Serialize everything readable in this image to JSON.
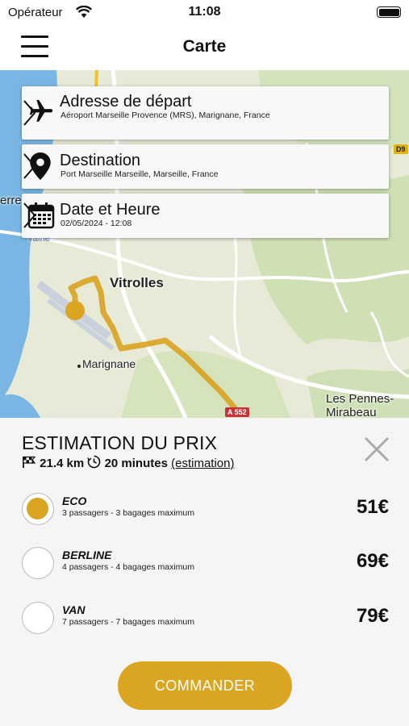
{
  "status_bar": {
    "carrier": "Opérateur",
    "time": "11:08"
  },
  "nav": {
    "title": "Carte"
  },
  "map": {
    "labels": {
      "vitrolles": "Vitrolles",
      "marignane": "Marignane",
      "pennes": "Les Pennes-\nMirabeau",
      "erre": "erre",
      "vaine": "Vaïne"
    },
    "badges": {
      "d9": "D9",
      "a552": "A 552"
    }
  },
  "cards": {
    "departure": {
      "title": "Adresse de départ",
      "subtitle": "Aéroport Marseille Provence (MRS), Marignane, France"
    },
    "destination": {
      "title": "Destination",
      "subtitle": "Port Marseille Marseille, Marseille, France"
    },
    "datetime": {
      "title": "Date et Heure",
      "subtitle": "02/05/2024 - 12:08"
    }
  },
  "estimate": {
    "title": "ESTIMATION DU PRIX",
    "distance": "21.4 km",
    "duration": "20 minutes",
    "note": "(estimation)"
  },
  "options": [
    {
      "name": "ECO",
      "desc": "3 passagers - 3 bagages maximum",
      "price": "51€",
      "selected": true
    },
    {
      "name": "BERLINE",
      "desc": "4 passagers - 4 bagages maximum",
      "price": "69€",
      "selected": false
    },
    {
      "name": "VAN",
      "desc": "7 passagers - 7 bagages maximum",
      "price": "79€",
      "selected": false
    }
  ],
  "order_button": "COMMANDER",
  "colors": {
    "accent": "#daa520",
    "route": "#d9a62a"
  }
}
